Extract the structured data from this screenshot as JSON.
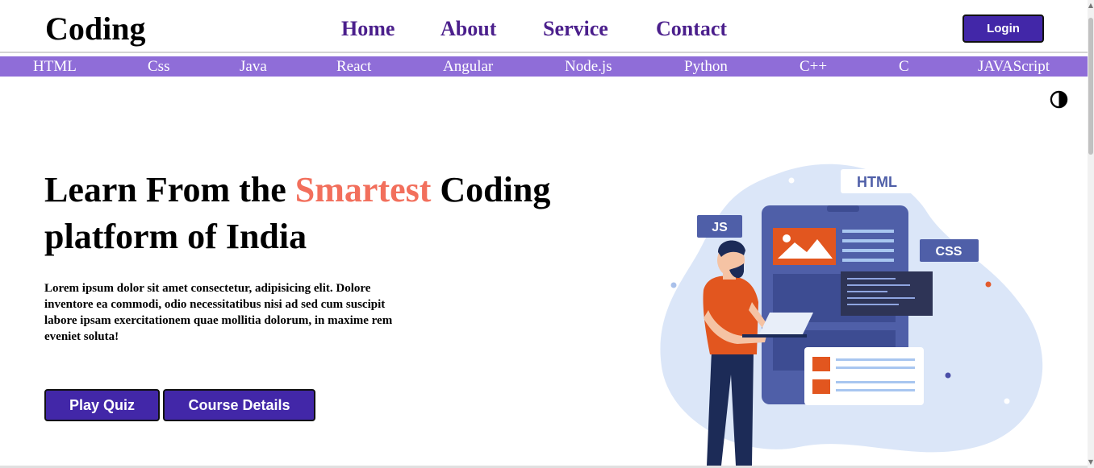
{
  "header": {
    "brand": "Coding",
    "nav": [
      "Home",
      "About",
      "Service",
      "Contact"
    ],
    "login_label": "Login"
  },
  "topics": [
    "HTML",
    "Css",
    "Java",
    "React",
    "Angular",
    "Node.js",
    "Python",
    "C++",
    "C",
    "JAVAScript"
  ],
  "hero": {
    "title_before": "Learn From the ",
    "title_highlight": "Smartest",
    "title_after": " Coding platform of India",
    "description": "Lorem ipsum dolor sit amet consectetur, adipisicing elit. Dolore inventore ea commodi, odio necessitatibus nisi ad sed cum suscipit labore ipsam exercitationem quae mollitia dolorum, in maxime rem eveniet soluta!",
    "buttons": {
      "quiz": "Play Quiz",
      "course": "Course Details"
    }
  },
  "illustration": {
    "tags": {
      "html": "HTML",
      "js": "JS",
      "css": "CSS"
    }
  },
  "icons": {
    "theme": "contrast-icon"
  },
  "colors": {
    "accent": "#4227a8",
    "topic_bar": "#8f6dd8",
    "nav_text": "#4b1f8c",
    "highlight": "#f26f5c"
  }
}
